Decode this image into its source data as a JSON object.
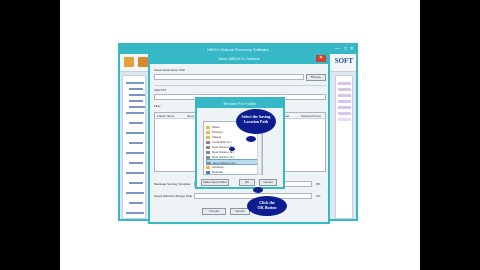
{
  "app": {
    "title": "MBOX Outlook Recovery Software",
    "min": "—",
    "max": "□",
    "close": "✕",
    "logo": "SOFT"
  },
  "export_dialog": {
    "title": "Save MBOX in Outlook",
    "close": "✕",
    "save_path_label": "Select Destination Path",
    "browse_label": "Browse",
    "split_label": "Split PST",
    "filter_label": "Filter",
    "col1": "Folder Name",
    "col2": "Items",
    "col3": "Date",
    "col4": "Selected Items",
    "msg1_label": "Message Naming Template",
    "msg2_label": "Select Mail Item Range Filter",
    "pct1": "0%",
    "pct2": "0%",
    "convert_label": "Convert",
    "cancel_label": "Cancel"
  },
  "browse_dialog": {
    "title": "Browse For Folder",
    "items": [
      {
        "label": "Music",
        "color": "#e7b84a"
      },
      {
        "label": "Pictures",
        "color": "#e7b84a"
      },
      {
        "label": "Videos",
        "color": "#e7b84a"
      },
      {
        "label": "Local Disk (C:)",
        "color": "#7f8a95"
      },
      {
        "label": "New Volume (D:)",
        "color": "#7f8a95"
      },
      {
        "label": "New Volume (E:)",
        "color": "#7f8a95"
      },
      {
        "label": "New Volume (F:)",
        "color": "#7f8a95"
      },
      {
        "label": "New Volume (G:)",
        "color": "#7f8a95"
      },
      {
        "label": "Libraries",
        "color": "#e7b84a"
      },
      {
        "label": "Network",
        "color": "#4a7fc7"
      }
    ],
    "make_folder": "Make New Folder",
    "ok": "OK",
    "cancel": "Cancel"
  },
  "callouts": {
    "first_line1": "Select the Saving",
    "first_line2": "Location Path",
    "second_line1": "Click the",
    "second_line2": "OK Button"
  }
}
